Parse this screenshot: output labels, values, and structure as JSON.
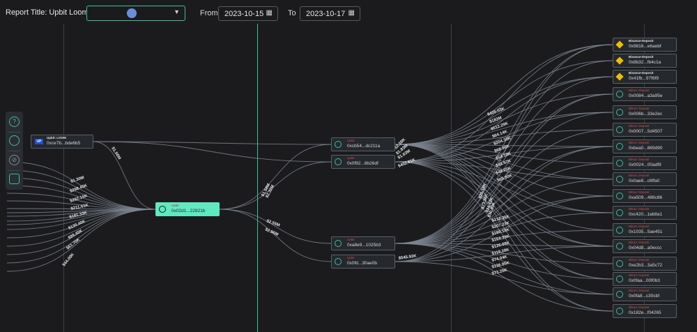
{
  "header": {
    "report_title": "Report Title: Upbit Loom",
    "from_label": "From",
    "from_date": "2023-10-15",
    "to_label": "To",
    "to_date": "2023-10-17",
    "token_icon": "loom-token-icon",
    "dropdown_icon": "chevron-down-icon",
    "calendar_icon": "calendar-icon"
  },
  "toolbar": {
    "items": [
      "help-icon",
      "refresh-icon",
      "hide-icon",
      "save-icon"
    ]
  },
  "colors": {
    "accent": "#3fbf9e",
    "selected_node": "#61e8c0",
    "background": "#1b1b1e",
    "edge": "#7d8590",
    "tag_red": "#d64b4b",
    "binance": "#f0b90b"
  },
  "nodes": {
    "source": {
      "tag": "Upbit: LOOM",
      "address": "0xce7b...bde6b5"
    },
    "center": {
      "tag": "Upbit",
      "address": "0x02d1...22821b"
    },
    "mid": [
      {
        "tag": "Upbit",
        "address": "0xcb54...dc211a"
      },
      {
        "tag": "Upbit",
        "address": "0x0f92...8b26df"
      },
      {
        "tag": "Upbit",
        "address": "0xa8e9...1025b3"
      },
      {
        "tag": "Upbit",
        "address": "0x0fd...30ae0b"
      }
    ],
    "right": [
      {
        "tag": "Binance-Deposit",
        "address": "0x9816...e6aebf"
      },
      {
        "tag": "Binance-Deposit",
        "address": "0x8b32...fb4c1a"
      },
      {
        "tag": "Binance-Deposit",
        "address": "0x41fb...97f6f9"
      },
      {
        "tag": "Bitrue: Deposit",
        "address": "0x0084...a3a95e"
      },
      {
        "tag": "Bitrue: Deposit",
        "address": "0x006b...33e2ec"
      },
      {
        "tag": "Bitrue: Deposit",
        "address": "0x0007...5d4507"
      },
      {
        "tag": "Bitrue: Deposit",
        "address": "0xbea0...869d90"
      },
      {
        "tag": "Bitrue: Deposit",
        "address": "0x0024...00adf9"
      },
      {
        "tag": "Bitrue: Deposit",
        "address": "0x0ae8...c6ffa0"
      },
      {
        "tag": "Bitrue: Deposit",
        "address": "0xa509...486c86"
      },
      {
        "tag": "Bitrue: Deposit",
        "address": "0xc420...1ab8a1"
      },
      {
        "tag": "Bitrue: Deposit",
        "address": "0x1035...5ae451"
      },
      {
        "tag": "Bitrue: Deposit",
        "address": "0x04d8...a0eccc"
      },
      {
        "tag": "Bitrue: Deposit",
        "address": "0xe2b3...3a5c72"
      },
      {
        "tag": "Bitrue: Deposit",
        "address": "0x0faa...00f0b3"
      },
      {
        "tag": "Bitrue: Deposit",
        "address": "0x0fa8...c30cbf"
      },
      {
        "tag": "Bitrue: Deposit",
        "address": "0x182e...f04265"
      }
    ]
  },
  "edge_labels": {
    "left_in": [
      "$1.30M",
      "$298.45K",
      "$282.15K",
      "$211.61K",
      "$181.33K",
      "$130.40K",
      "$99.45K",
      "$61.70K",
      "$44.09K"
    ],
    "source_to_center": "$1.56M",
    "center_to_mid_top": [
      "$1.58M",
      "$2.32M"
    ],
    "center_to_mid_bottom": [
      "$2.55M",
      "$2.96M"
    ],
    "mid_top_out": [
      "$2.38K",
      "$1.83M",
      "$1.63M",
      "$402.81K"
    ],
    "fan_upper": [
      "$405.53K",
      "$182M",
      "$512.29K",
      "$64.14K",
      "$204.39K",
      "$68.96K",
      "$54.12K",
      "$49.57K",
      "$48.25K",
      "$65.80K"
    ],
    "fan_diag": [
      "$25.18K",
      "$73.38K",
      "$24.43K",
      "$30.80K"
    ],
    "fan_lower": [
      "$218.36K",
      "$207.23K",
      "$160.10K",
      "$164.33K",
      "$126.09K",
      "$119.28K",
      "$74.04K",
      "$136.85K",
      "$73.25K"
    ],
    "mid_bottom_out": "$545.93K"
  }
}
